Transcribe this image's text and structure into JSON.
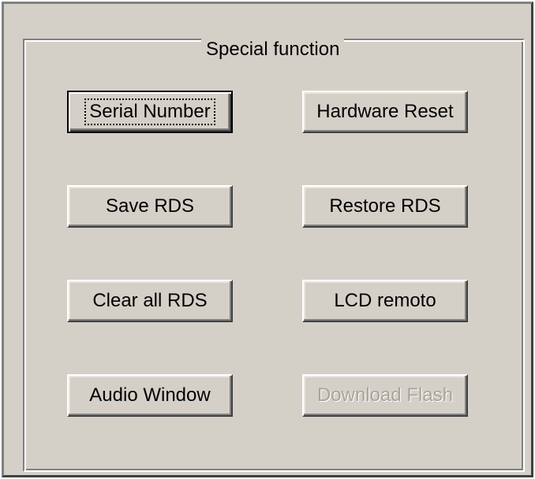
{
  "group": {
    "title": "Special function"
  },
  "buttons": {
    "serial_number": "Serial Number",
    "hardware_reset": "Hardware Reset",
    "save_rds": "Save RDS",
    "restore_rds": "Restore RDS",
    "clear_all_rds": "Clear all RDS",
    "lcd_remoto": "LCD remoto",
    "audio_window": "Audio Window",
    "download_flash": "Download Flash"
  }
}
